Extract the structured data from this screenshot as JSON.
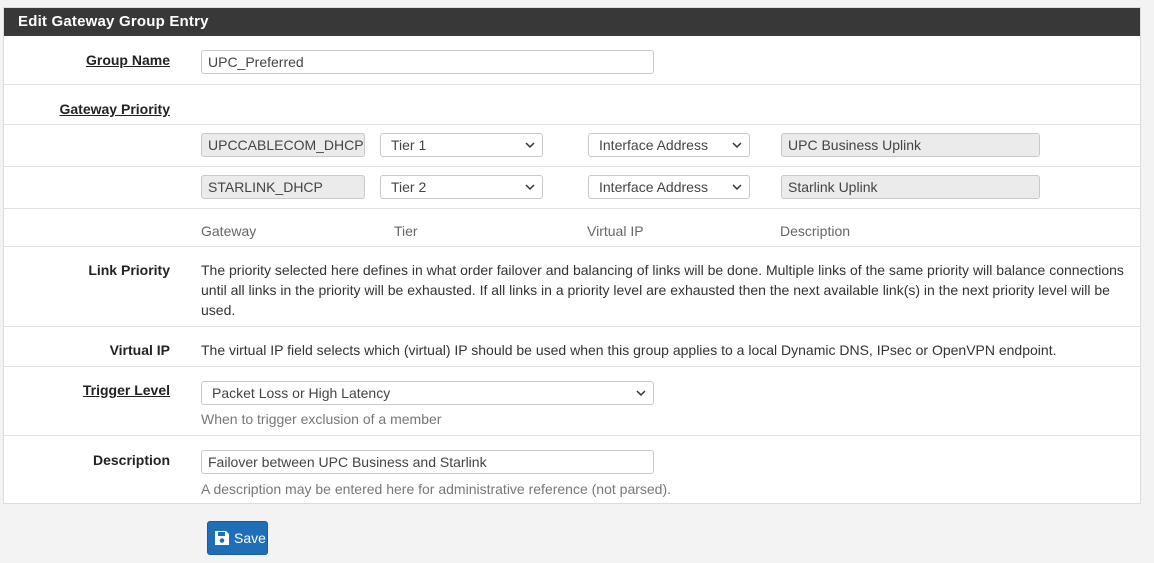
{
  "panel": {
    "title": "Edit Gateway Group Entry"
  },
  "group_name": {
    "label": "Group Name",
    "value": "UPC_Preferred"
  },
  "gateway_priority": {
    "label": "Gateway Priority",
    "rows": [
      {
        "gateway": "UPCCABLECOM_DHCP",
        "tier": "Tier 1",
        "virtual_ip": "Interface Address",
        "description": "UPC Business Uplink"
      },
      {
        "gateway": "STARLINK_DHCP",
        "tier": "Tier 2",
        "virtual_ip": "Interface Address",
        "description": "Starlink Uplink"
      }
    ],
    "columns": {
      "gateway": "Gateway",
      "tier": "Tier",
      "virtual_ip": "Virtual IP",
      "description": "Description"
    }
  },
  "link_priority": {
    "label": "Link Priority",
    "text": "The priority selected here defines in what order failover and balancing of links will be done. Multiple links of the same priority will balance connections until all links in the priority will be exhausted. If all links in a priority level are exhausted then the next available link(s) in the next priority level will be used."
  },
  "virtual_ip": {
    "label": "Virtual IP",
    "text": "The virtual IP field selects which (virtual) IP should be used when this group applies to a local Dynamic DNS, IPsec or OpenVPN endpoint."
  },
  "trigger_level": {
    "label": "Trigger Level",
    "value": "Packet Loss or High Latency",
    "help": "When to trigger exclusion of a member"
  },
  "description": {
    "label": "Description",
    "value": "Failover between UPC Business and Starlink",
    "help": "A description may be entered here for administrative reference (not parsed)."
  },
  "save_button": {
    "label": "Save"
  },
  "colors": {
    "header_bg": "#383838",
    "save_bg": "#1e6fb8"
  }
}
